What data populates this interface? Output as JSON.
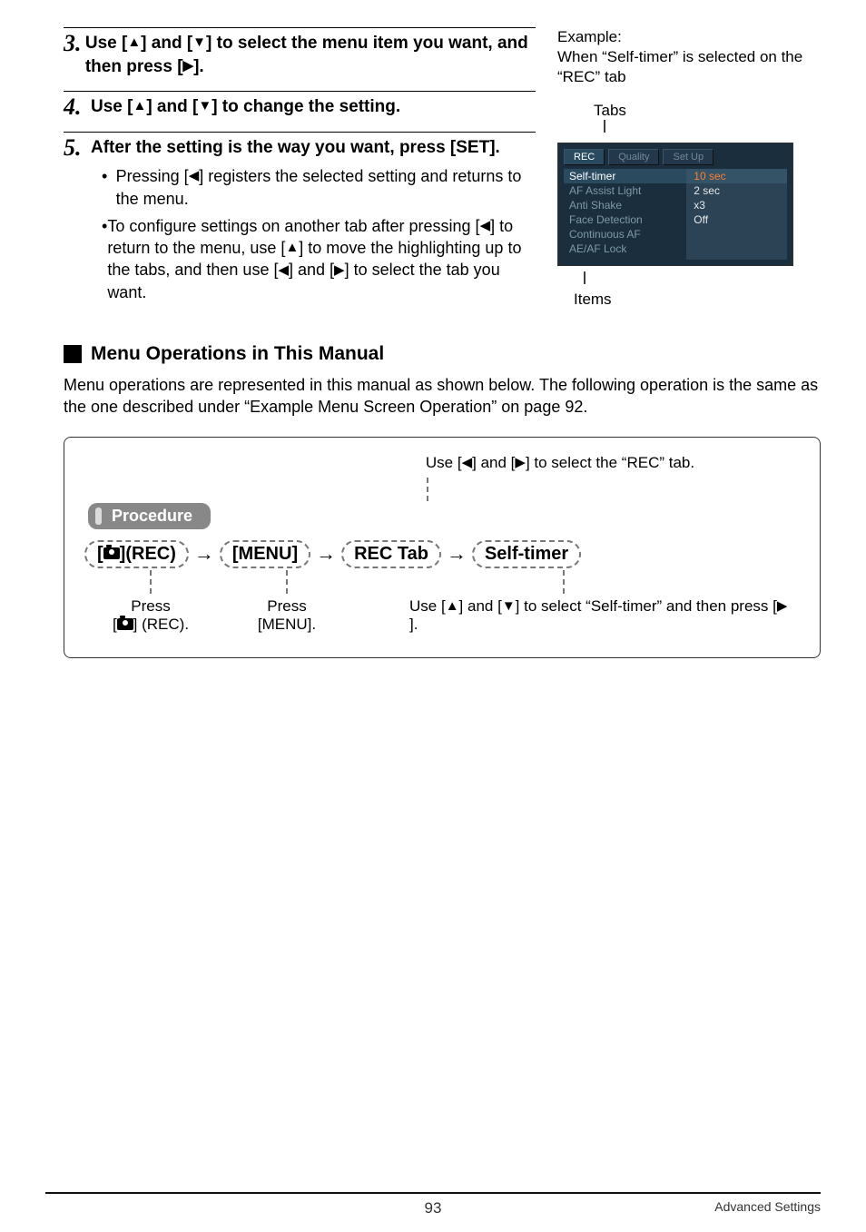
{
  "steps": [
    {
      "num": "3.",
      "text_a": "Use [",
      "text_b": "] and [",
      "text_c": "] to select the menu item you want, and then press [",
      "text_d": "]."
    },
    {
      "num": "4.",
      "text_a": "Use [",
      "text_b": "] and [",
      "text_c": "] to change the setting."
    },
    {
      "num": "5.",
      "text": "After the setting is the way you want, press [SET].",
      "bullets": [
        {
          "a": "Pressing [",
          "b": "] registers the selected setting and returns to the menu."
        },
        {
          "a": "To configure settings on another tab after pressing [",
          "b": "] to return to the menu, use [",
          "c": "] to move the highlighting up to the tabs, and then use [",
          "d": "] and [",
          "e": "] to select the tab you want."
        }
      ]
    }
  ],
  "example": {
    "line1": "Example:",
    "line2": "When “Self-timer” is selected on the “REC” tab"
  },
  "screen": {
    "tabs_label": "Tabs",
    "items_label": "Items",
    "tabs": [
      "REC",
      "Quality",
      "Set Up"
    ],
    "items": [
      "Self-timer",
      "AF Assist Light",
      "Anti Shake",
      "Face Detection",
      "Continuous AF",
      "AE/AF Lock"
    ],
    "values": [
      "10 sec",
      "2 sec",
      "x3",
      "Off"
    ]
  },
  "section": {
    "title": "Menu Operations in This Manual",
    "para": "Menu operations are represented in this manual as shown below. The following operation is the same as the one described under “Example Menu Screen Operation” on page 92."
  },
  "procedure": {
    "top_label_a": "Use [",
    "top_label_b": "] and [",
    "top_label_c": "] to select the “REC” tab.",
    "badge": "Procedure",
    "chain": {
      "rec": "(REC)",
      "menu": "[MENU]",
      "rectab": "REC Tab",
      "selftimer": "Self-timer"
    },
    "under": {
      "press": "Press",
      "rec_a": "[",
      "rec_b": "] (REC).",
      "menu": "[MENU].",
      "sel_a": "Use [",
      "sel_b": "] and [",
      "sel_c": "] to select “Self-timer” and then press [",
      "sel_d": "]."
    }
  },
  "footer": {
    "page": "93",
    "right": "Advanced Settings"
  }
}
